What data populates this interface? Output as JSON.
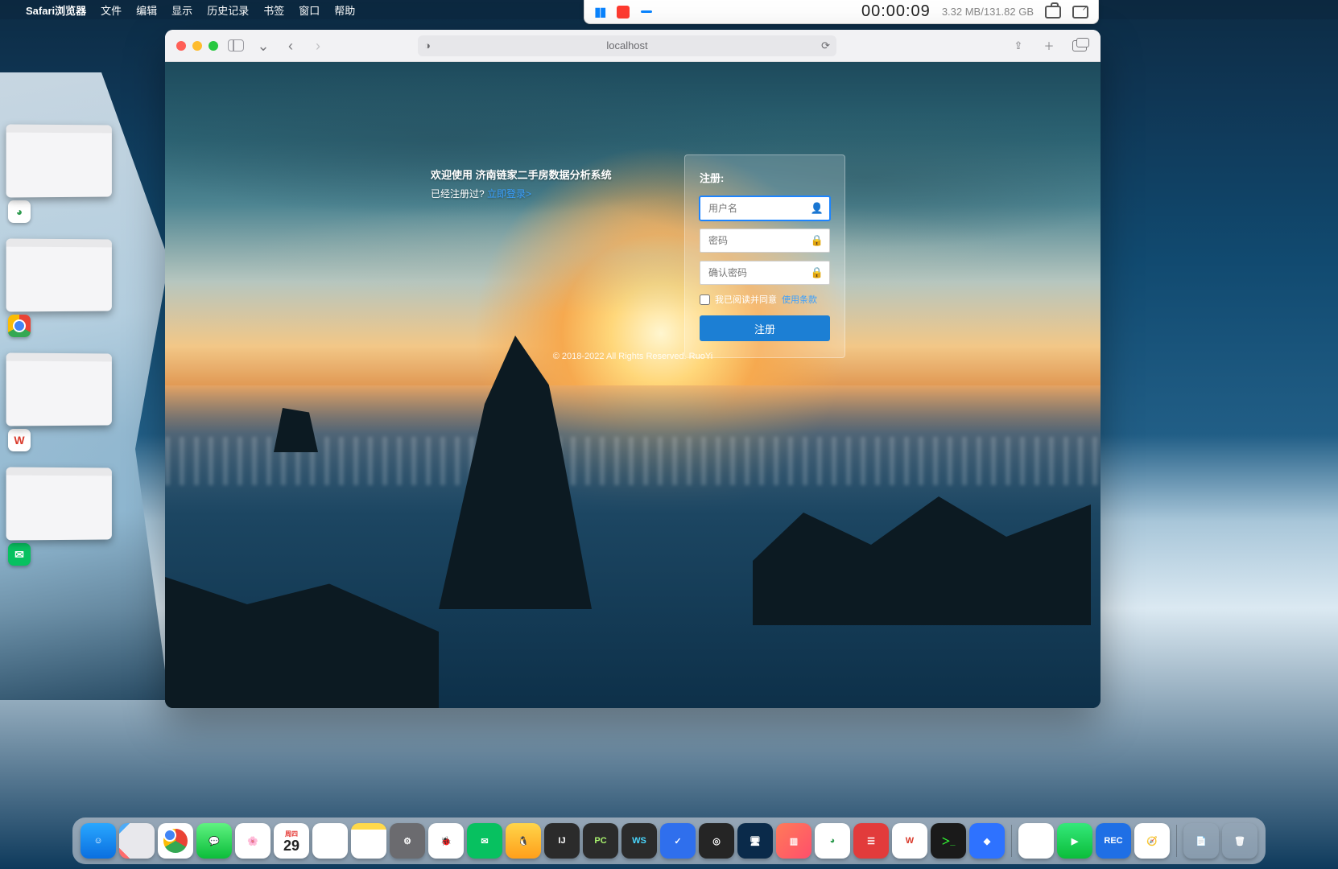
{
  "menubar": {
    "app": "Safari浏览器",
    "items": [
      "文件",
      "编辑",
      "显示",
      "历史记录",
      "书签",
      "窗口",
      "帮助"
    ]
  },
  "recorder": {
    "time": "00:00:09",
    "size": "3.32 MB/131.82 GB"
  },
  "safari": {
    "address": "localhost"
  },
  "page": {
    "welcome_title": "欢迎使用 济南链家二手房数据分析系统",
    "registered_prefix": "已经注册过?",
    "login_link": "立即登录>",
    "card_title": "注册:",
    "username_ph": "用户名",
    "password_ph": "密码",
    "confirm_ph": "确认密码",
    "agree_text": "我已阅读并同意",
    "terms_link": "使用条款",
    "submit": "注册",
    "copyright": "© 2018-2022 All Rights Reserved. RuoYi"
  },
  "calendar": {
    "weekday": "周四",
    "day": "29"
  },
  "dock": {
    "ij": "IJ",
    "py": "PC",
    "ws": "WS"
  }
}
